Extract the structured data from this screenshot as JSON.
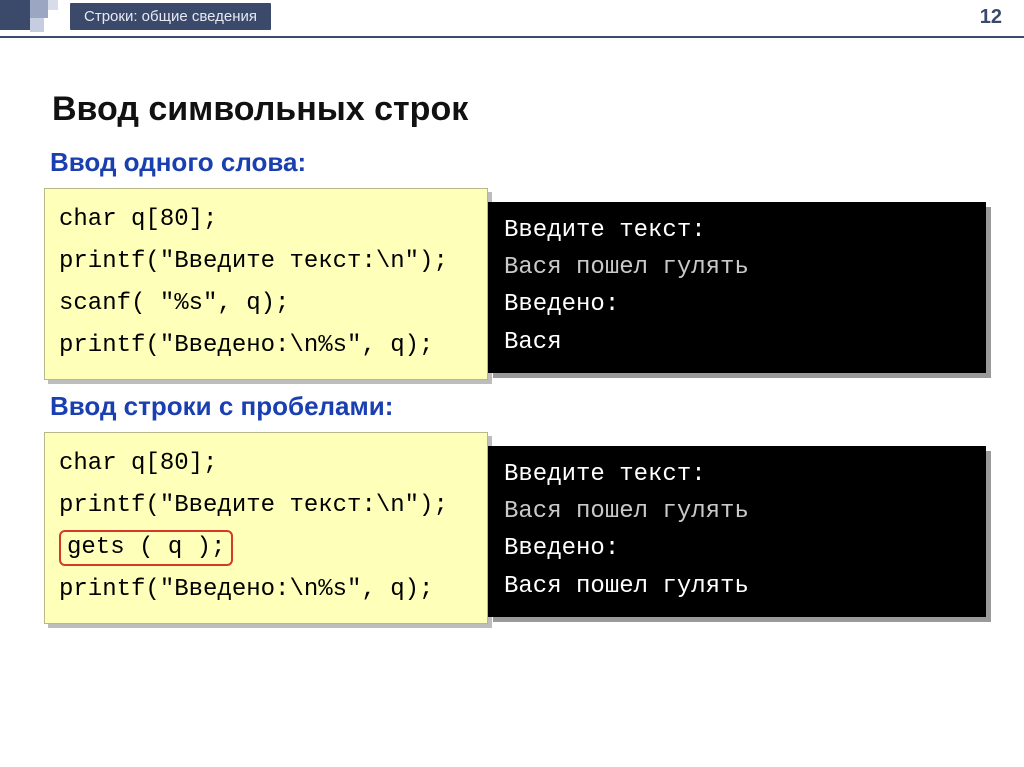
{
  "page": {
    "breadcrumb": "Строки: общие сведения",
    "number": "12",
    "title": "Ввод символьных строк"
  },
  "section1": {
    "heading": "Ввод одного слова:",
    "code": {
      "l1": "char q[80];",
      "l2": "printf(\"Введите текст:\\n\");",
      "l3": "scanf( \"%s\", q);",
      "l4": "printf(\"Введено:\\n%s\", q);"
    },
    "term": {
      "l1": "Введите текст:",
      "l2": "Вася пошел гулять",
      "l3": "Введено:",
      "l4": "Вася"
    }
  },
  "section2": {
    "heading": "Ввод строки с пробелами:",
    "code": {
      "l1": "char q[80];",
      "l2": "printf(\"Введите текст:\\n\");",
      "l3_hl": "gets ( q );",
      "l4": "printf(\"Введено:\\n%s\", q);"
    },
    "term": {
      "l1": "Введите текст:",
      "l2": "Вася пошел гулять",
      "l3": "Введено:",
      "l4": "Вася пошел гулять"
    }
  }
}
